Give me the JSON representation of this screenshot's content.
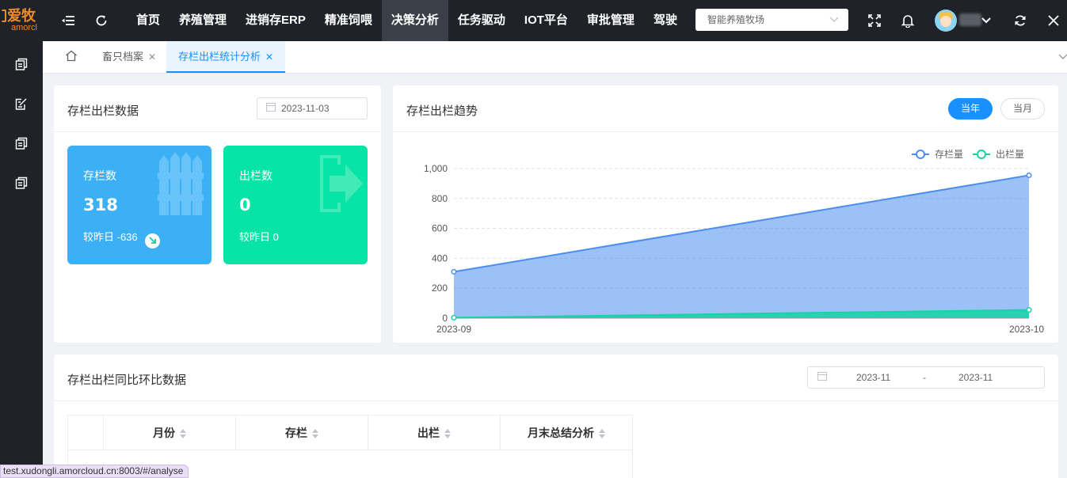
{
  "app": {
    "logo_text": "爱牧",
    "logo_sub": "amorcl"
  },
  "nav": [
    {
      "label": "首页"
    },
    {
      "label": "养殖管理"
    },
    {
      "label": "进销存ERP"
    },
    {
      "label": "精准饲喂"
    },
    {
      "label": "决策分析"
    },
    {
      "label": "任务驱动"
    },
    {
      "label": "IOT平台"
    },
    {
      "label": "审批管理"
    },
    {
      "label": "驾驶"
    }
  ],
  "farm_select": {
    "value": "智能养殖牧场"
  },
  "tabs": [
    {
      "label": "畜只档案"
    },
    {
      "label": "存栏出栏统计分析"
    }
  ],
  "stock_card": {
    "title": "存栏出栏数据",
    "date": "2023-11-03",
    "inventory": {
      "label": "存栏数",
      "value": "318",
      "compare": "较昨日 -636",
      "color": "#3cb0f5"
    },
    "outbound": {
      "label": "出栏数",
      "value": "0",
      "compare": "较昨日 0",
      "color": "#07e4a6"
    }
  },
  "trend_card": {
    "title": "存栏出栏趋势",
    "btn_year": "当年",
    "btn_month": "当月"
  },
  "chart_data": {
    "type": "area",
    "x": [
      "2023-09",
      "2023-10"
    ],
    "series": [
      {
        "name": "存栏量",
        "values": [
          310,
          955
        ],
        "color": "#4b8ef0"
      },
      {
        "name": "出栏量",
        "values": [
          3,
          55
        ],
        "color": "#14d4a4"
      }
    ],
    "ylim": [
      0,
      1000
    ],
    "yticks": [
      "0",
      "200",
      "400",
      "600",
      "800",
      "1,000"
    ],
    "legend": "top-right",
    "grid": true
  },
  "compare_card": {
    "title": "存栏出栏同比环比数据",
    "range_start": "2023-11",
    "range_sep": "-",
    "range_end": "2023-11",
    "columns": [
      "月份",
      "存栏",
      "出栏",
      "月末总结分析"
    ]
  },
  "status_url": "test.xudongli.amorcloud.cn:8003/#/analyse"
}
